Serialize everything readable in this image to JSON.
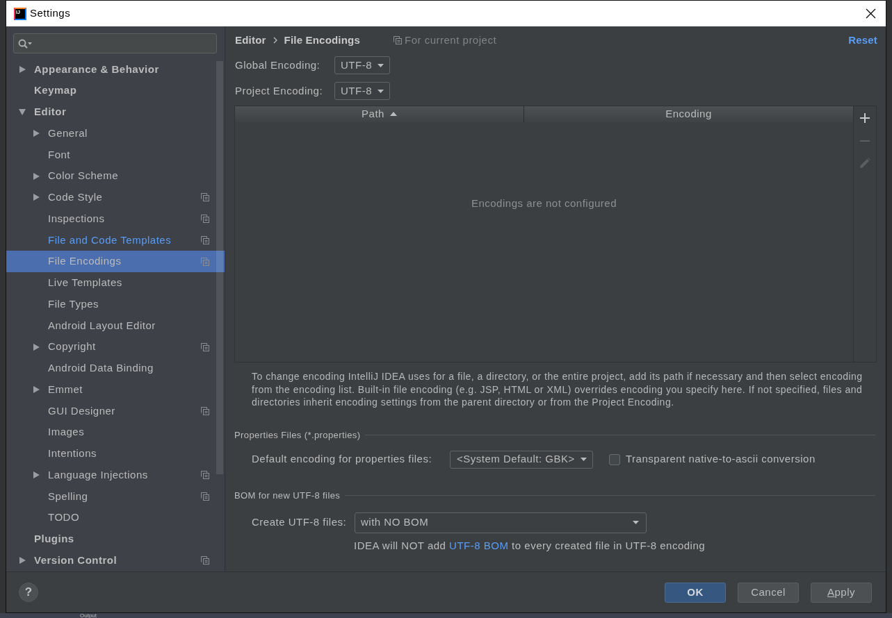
{
  "window": {
    "title": "Settings",
    "logo_text": "IJ"
  },
  "background": {
    "tool_window_tab": "Output"
  },
  "sidebar": {
    "items": [
      {
        "label": "Appearance & Behavior",
        "kind": "group",
        "expanded": false,
        "selected": false,
        "modified": false,
        "project_level": false
      },
      {
        "label": "Keymap",
        "kind": "leaf",
        "selected": false,
        "modified": false,
        "project_level": false
      },
      {
        "label": "Editor",
        "kind": "group",
        "expanded": true,
        "selected": false,
        "modified": false,
        "project_level": false,
        "children": [
          {
            "label": "General",
            "kind": "group",
            "expanded": false,
            "selected": false,
            "modified": false,
            "project_level": false
          },
          {
            "label": "Font",
            "kind": "leaf",
            "selected": false,
            "modified": false,
            "project_level": false
          },
          {
            "label": "Color Scheme",
            "kind": "group",
            "expanded": false,
            "selected": false,
            "modified": false,
            "project_level": false
          },
          {
            "label": "Code Style",
            "kind": "group",
            "expanded": false,
            "selected": false,
            "modified": false,
            "project_level": true
          },
          {
            "label": "Inspections",
            "kind": "leaf",
            "selected": false,
            "modified": false,
            "project_level": true
          },
          {
            "label": "File and Code Templates",
            "kind": "leaf",
            "selected": false,
            "modified": true,
            "project_level": true
          },
          {
            "label": "File Encodings",
            "kind": "leaf",
            "selected": true,
            "modified": false,
            "project_level": true
          },
          {
            "label": "Live Templates",
            "kind": "leaf",
            "selected": false,
            "modified": false,
            "project_level": false
          },
          {
            "label": "File Types",
            "kind": "leaf",
            "selected": false,
            "modified": false,
            "project_level": false
          },
          {
            "label": "Android Layout Editor",
            "kind": "leaf",
            "selected": false,
            "modified": false,
            "project_level": false
          },
          {
            "label": "Copyright",
            "kind": "group",
            "expanded": false,
            "selected": false,
            "modified": false,
            "project_level": true
          },
          {
            "label": "Android Data Binding",
            "kind": "leaf",
            "selected": false,
            "modified": false,
            "project_level": false
          },
          {
            "label": "Emmet",
            "kind": "group",
            "expanded": false,
            "selected": false,
            "modified": false,
            "project_level": false
          },
          {
            "label": "GUI Designer",
            "kind": "leaf",
            "selected": false,
            "modified": false,
            "project_level": true
          },
          {
            "label": "Images",
            "kind": "leaf",
            "selected": false,
            "modified": false,
            "project_level": false
          },
          {
            "label": "Intentions",
            "kind": "leaf",
            "selected": false,
            "modified": false,
            "project_level": false
          },
          {
            "label": "Language Injections",
            "kind": "group",
            "expanded": false,
            "selected": false,
            "modified": false,
            "project_level": true
          },
          {
            "label": "Spelling",
            "kind": "leaf",
            "selected": false,
            "modified": false,
            "project_level": true
          },
          {
            "label": "TODO",
            "kind": "leaf",
            "selected": false,
            "modified": false,
            "project_level": false
          }
        ]
      },
      {
        "label": "Plugins",
        "kind": "leaf",
        "selected": false,
        "modified": false,
        "project_level": false
      },
      {
        "label": "Version Control",
        "kind": "group",
        "expanded": false,
        "selected": false,
        "modified": false,
        "project_level": true
      }
    ]
  },
  "breadcrumb": [
    {
      "label": "Editor"
    },
    {
      "label": "File Encodings"
    }
  ],
  "scope_note": "For current project",
  "reset_link": "Reset",
  "encodings": [
    {
      "label": "Global Encoding:",
      "value": "UTF-8"
    },
    {
      "label": "Project Encoding:",
      "value": "UTF-8"
    }
  ],
  "table": {
    "columns": [
      {
        "label": "Path",
        "sorted": true
      },
      {
        "label": "Encoding",
        "sorted": false
      }
    ],
    "empty_text": "Encodings are not configured",
    "toolbar": [
      {
        "kind": "add",
        "disabled": false
      },
      {
        "kind": "remove",
        "disabled": true
      },
      {
        "kind": "edit",
        "disabled": true
      }
    ]
  },
  "info_text": "To change encoding IntelliJ IDEA uses for a file, a directory, or the entire project, add its path if necessary and then select encoding from the encoding list. Built-in file encoding (e.g. JSP, HTML or XML) overrides encoding you specify here. If not specified, files and directories inherit encoding settings from the parent directory or from the Project Encoding.",
  "properties_files": {
    "title": "Properties Files (*.properties)",
    "label": "Default encoding for properties files:",
    "value": "<System Default: GBK>",
    "checkbox": {
      "label": "Transparent native-to-ascii conversion",
      "checked": false
    }
  },
  "bom": {
    "title": "BOM for new UTF-8 files",
    "label": "Create UTF-8 files:",
    "value": "with NO BOM",
    "note": {
      "before": "IDEA will NOT add ",
      "link": "UTF-8 BOM",
      "after": " to every created file in UTF-8 encoding"
    }
  },
  "footer": {
    "help_button": "?",
    "buttons": [
      {
        "label": "OK",
        "kind": "primary",
        "mnemonic": false
      },
      {
        "label": "Cancel",
        "kind": "default",
        "mnemonic": false
      },
      {
        "label": "Apply",
        "kind": "default",
        "mnemonic": true
      }
    ]
  }
}
